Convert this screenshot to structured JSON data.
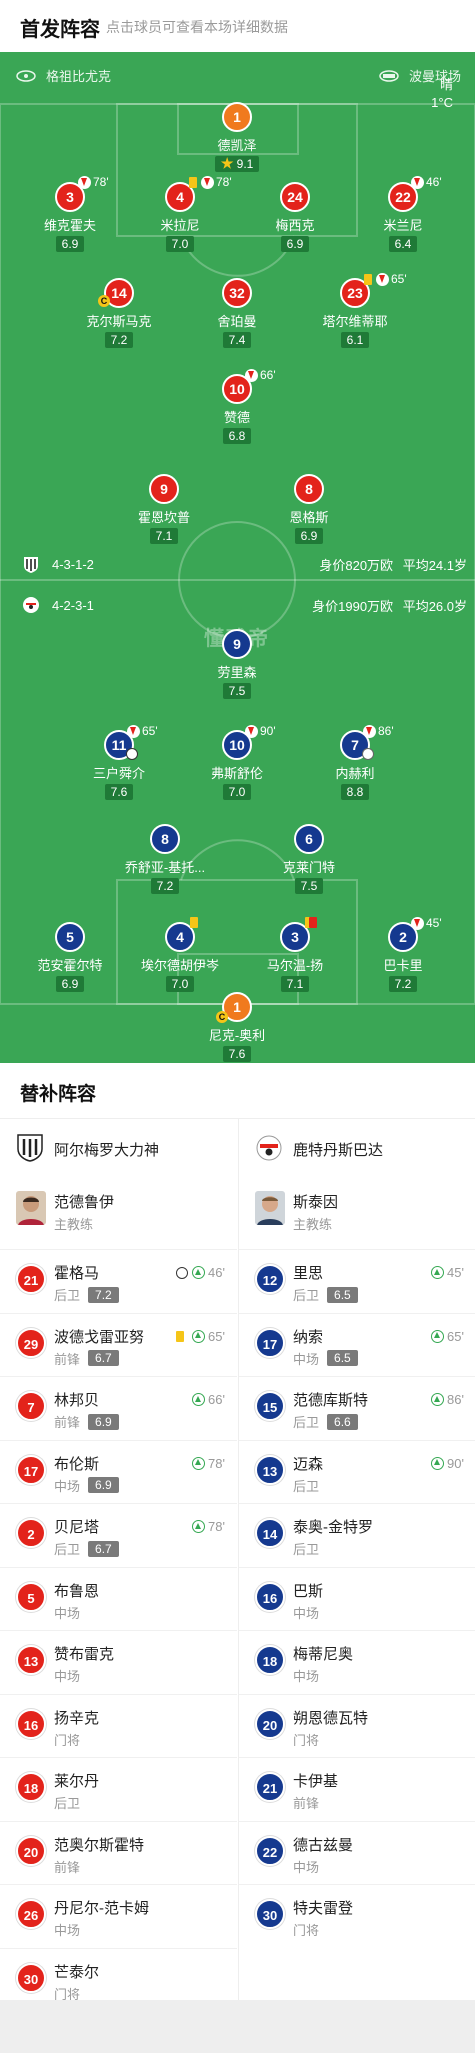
{
  "header": {
    "title": "首发阵容",
    "subtitle": "点击球员可查看本场详细数据"
  },
  "pitch": {
    "home_team": "格祖比尤克",
    "away_team": "波曼球场",
    "weather": {
      "condition": "晴",
      "temperature": "1°C"
    },
    "logo_text": "懂球帝",
    "home_formation": {
      "formation": "4-3-1-2",
      "value": "身价820万欧",
      "age": "平均24.1岁"
    },
    "away_formation": {
      "formation": "4-2-3-1",
      "value": "身价1990万欧",
      "age": "平均26.0岁"
    }
  },
  "home_players": [
    {
      "num": "1",
      "name": "德凯泽",
      "rating": "9.1",
      "gk": true,
      "star": true
    },
    {
      "num": "3",
      "name": "维克霍夫",
      "rating": "6.9",
      "sub": "78'"
    },
    {
      "num": "4",
      "name": "米拉尼",
      "rating": "7.0",
      "sub": "78'",
      "yellow": true
    },
    {
      "num": "24",
      "name": "梅西克",
      "rating": "6.9"
    },
    {
      "num": "22",
      "name": "米兰尼",
      "rating": "6.4",
      "sub": "46'"
    },
    {
      "num": "14",
      "name": "克尔斯马克",
      "rating": "7.2",
      "captain": true
    },
    {
      "num": "32",
      "name": "舍珀曼",
      "rating": "7.4"
    },
    {
      "num": "23",
      "name": "塔尔维蒂耶",
      "rating": "6.1",
      "sub": "65'",
      "yellow": true
    },
    {
      "num": "10",
      "name": "赞德",
      "rating": "6.8",
      "sub": "66'"
    },
    {
      "num": "9",
      "name": "霍恩坎普",
      "rating": "7.1"
    },
    {
      "num": "8",
      "name": "恩格斯",
      "rating": "6.9"
    }
  ],
  "away_players": [
    {
      "num": "9",
      "name": "劳里森",
      "rating": "7.5"
    },
    {
      "num": "11",
      "name": "三户舜介",
      "rating": "7.6",
      "sub": "65'",
      "goal": true
    },
    {
      "num": "10",
      "name": "弗斯舒伦",
      "rating": "7.0",
      "sub": "90'"
    },
    {
      "num": "7",
      "name": "内赫利",
      "rating": "8.8",
      "sub": "86'",
      "assist": true
    },
    {
      "num": "8",
      "name": "乔舒亚-基托...",
      "rating": "7.2"
    },
    {
      "num": "6",
      "name": "克莱门特",
      "rating": "7.5"
    },
    {
      "num": "5",
      "name": "范安霍尔特",
      "rating": "6.9"
    },
    {
      "num": "4",
      "name": "埃尔德胡伊岑",
      "rating": "7.0",
      "yellow": true
    },
    {
      "num": "3",
      "name": "马尔温-扬",
      "rating": "7.1",
      "red_yellow": true
    },
    {
      "num": "2",
      "name": "巴卡里",
      "rating": "7.2",
      "sub": "45'"
    },
    {
      "num": "1",
      "name": "尼克-奥利",
      "rating": "7.6",
      "gk": true,
      "captain": true
    }
  ],
  "bench": {
    "title": "替补阵容",
    "home": {
      "team": "阿尔梅罗大力神",
      "coach": {
        "name": "范德鲁伊",
        "role": "主教练"
      },
      "players": [
        {
          "num": "21",
          "name": "霍格马",
          "pos": "后卫",
          "rating": "7.2",
          "goal": true,
          "on": "46'"
        },
        {
          "num": "29",
          "name": "波德戈雷亚努",
          "pos": "前锋",
          "rating": "6.7",
          "yellow": true,
          "on": "65'"
        },
        {
          "num": "7",
          "name": "林邦贝",
          "pos": "前锋",
          "rating": "6.9",
          "on": "66'"
        },
        {
          "num": "17",
          "name": "布伦斯",
          "pos": "中场",
          "rating": "6.9",
          "on": "78'"
        },
        {
          "num": "2",
          "name": "贝尼塔",
          "pos": "后卫",
          "rating": "6.7",
          "on": "78'"
        },
        {
          "num": "5",
          "name": "布鲁恩",
          "pos": "中场"
        },
        {
          "num": "13",
          "name": "赞布雷克",
          "pos": "中场"
        },
        {
          "num": "16",
          "name": "扬辛克",
          "pos": "门将"
        },
        {
          "num": "18",
          "name": "莱尔丹",
          "pos": "后卫"
        },
        {
          "num": "20",
          "name": "范奥尔斯霍特",
          "pos": "前锋"
        },
        {
          "num": "26",
          "name": "丹尼尔-范卡姆",
          "pos": "中场"
        },
        {
          "num": "30",
          "name": "芒泰尔",
          "pos": "门将"
        }
      ]
    },
    "away": {
      "team": "鹿特丹斯巴达",
      "coach": {
        "name": "斯泰因",
        "role": "主教练"
      },
      "players": [
        {
          "num": "12",
          "name": "里思",
          "pos": "后卫",
          "rating": "6.5",
          "on": "45'"
        },
        {
          "num": "17",
          "name": "纳索",
          "pos": "中场",
          "rating": "6.5",
          "on": "65'"
        },
        {
          "num": "15",
          "name": "范德库斯特",
          "pos": "后卫",
          "rating": "6.6",
          "on": "86'"
        },
        {
          "num": "13",
          "name": "迈森",
          "pos": "后卫",
          "on": "90'"
        },
        {
          "num": "14",
          "name": "泰奥-金特罗",
          "pos": "后卫"
        },
        {
          "num": "16",
          "name": "巴斯",
          "pos": "中场"
        },
        {
          "num": "18",
          "name": "梅蒂尼奥",
          "pos": "中场"
        },
        {
          "num": "20",
          "name": "朔恩德瓦特",
          "pos": "门将"
        },
        {
          "num": "21",
          "name": "卡伊基",
          "pos": "前锋"
        },
        {
          "num": "22",
          "name": "德古兹曼",
          "pos": "中场"
        },
        {
          "num": "30",
          "name": "特夫雷登",
          "pos": "门将"
        }
      ]
    }
  }
}
